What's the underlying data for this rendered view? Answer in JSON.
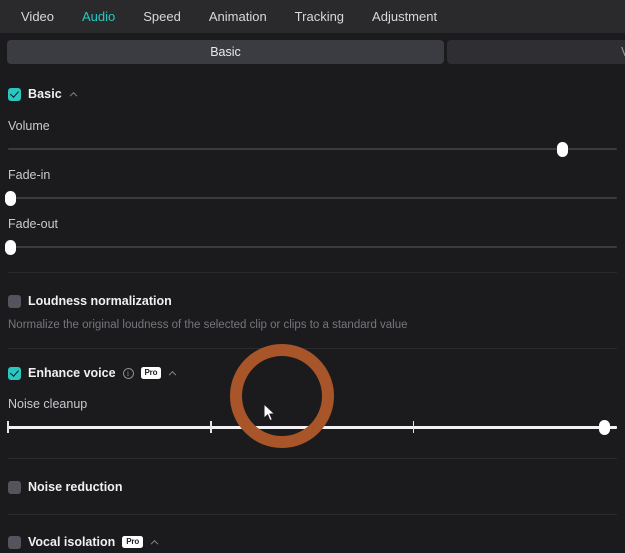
{
  "tabs": [
    {
      "label": "Video",
      "active": false
    },
    {
      "label": "Audio",
      "active": true
    },
    {
      "label": "Speed",
      "active": false
    },
    {
      "label": "Animation",
      "active": false
    },
    {
      "label": "Tracking",
      "active": false
    },
    {
      "label": "Adjustment",
      "active": false
    }
  ],
  "segments": [
    {
      "label": "Basic",
      "active": true
    },
    {
      "label": "V",
      "active": false
    }
  ],
  "sections": {
    "basic": {
      "title": "Basic",
      "checked": true,
      "sliders": [
        {
          "label": "Volume",
          "percent": 91,
          "lit": false,
          "ticks": []
        },
        {
          "label": "Fade-in",
          "percent": 0.4,
          "lit": false,
          "ticks": []
        },
        {
          "label": "Fade-out",
          "percent": 0.4,
          "lit": false,
          "ticks": []
        }
      ]
    },
    "loudness": {
      "title": "Loudness normalization",
      "checked": false,
      "description": "Normalize the original loudness of the selected clip or clips to a standard value"
    },
    "enhance_voice": {
      "title": "Enhance voice",
      "checked": true,
      "badge": "Pro",
      "info": "i",
      "slider": {
        "label": "Noise cleanup",
        "percent": 98,
        "lit": true,
        "ticks": [
          33.3,
          66.6
        ]
      }
    },
    "noise_reduction": {
      "title": "Noise reduction",
      "checked": false
    },
    "vocal_isolation": {
      "title": "Vocal isolation",
      "checked": false,
      "badge": "Pro"
    }
  },
  "annotation": {
    "ring_color": "#a8552a",
    "accent_color": "#2ac7c0"
  }
}
